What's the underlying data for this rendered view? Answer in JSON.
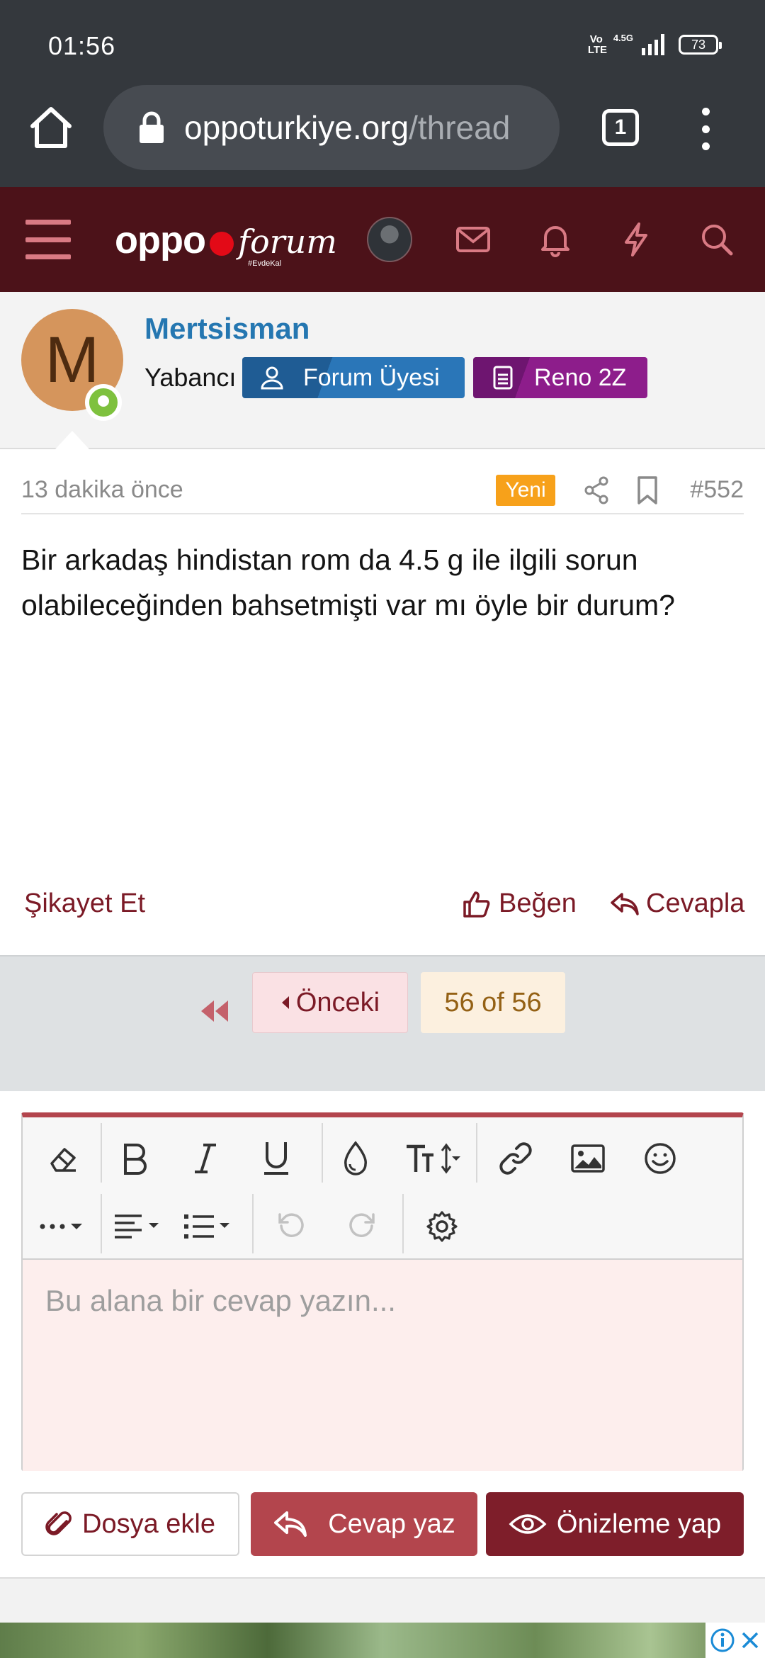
{
  "status_bar": {
    "time": "01:56",
    "volte": "Vo LTE",
    "network": "4.5G",
    "battery": "73"
  },
  "browser": {
    "url_host": "oppoturkiye.org",
    "url_path": "/thread",
    "tab_count": "1"
  },
  "site_header": {
    "logo_text": "oppo",
    "logo_script": "forum",
    "logo_tagline": "#EvdeKal"
  },
  "post": {
    "username": "Mertsisman",
    "avatar_letter": "M",
    "role": "Yabancı",
    "badges": [
      "Forum Üyesi",
      "Reno 2Z"
    ],
    "time_ago": "13 dakika önce",
    "new_badge": "Yeni",
    "post_number": "#552",
    "body": "Bir arkadaş hindistan rom da 4.5 g ile ilgili sorun olabileceğinden bahsetmişti var mı öyle bir durum?",
    "report_label": "Şikayet Et",
    "like_label": "Beğen",
    "reply_label": "Cevapla"
  },
  "pagination": {
    "prev_label": "Önceki",
    "page_status": "56 of 56"
  },
  "editor": {
    "placeholder": "Bu alana bir cevap yazın...",
    "toolbar_icons": [
      "eraser-icon",
      "bold-icon",
      "italic-icon",
      "underline-icon",
      "color-drop-icon",
      "text-size-icon",
      "link-icon",
      "image-icon",
      "emoji-icon",
      "more-icon",
      "align-icon",
      "list-icon",
      "undo-icon",
      "redo-icon",
      "settings-icon"
    ]
  },
  "actions": {
    "attach_label": "Dosya ekle",
    "submit_label": "Cevap yaz",
    "preview_label": "Önizleme yap"
  },
  "colors": {
    "header_bg": "#4c1219",
    "accent": "#b3454d",
    "link_blue": "#2577b1",
    "new_badge": "#f7a11a"
  }
}
